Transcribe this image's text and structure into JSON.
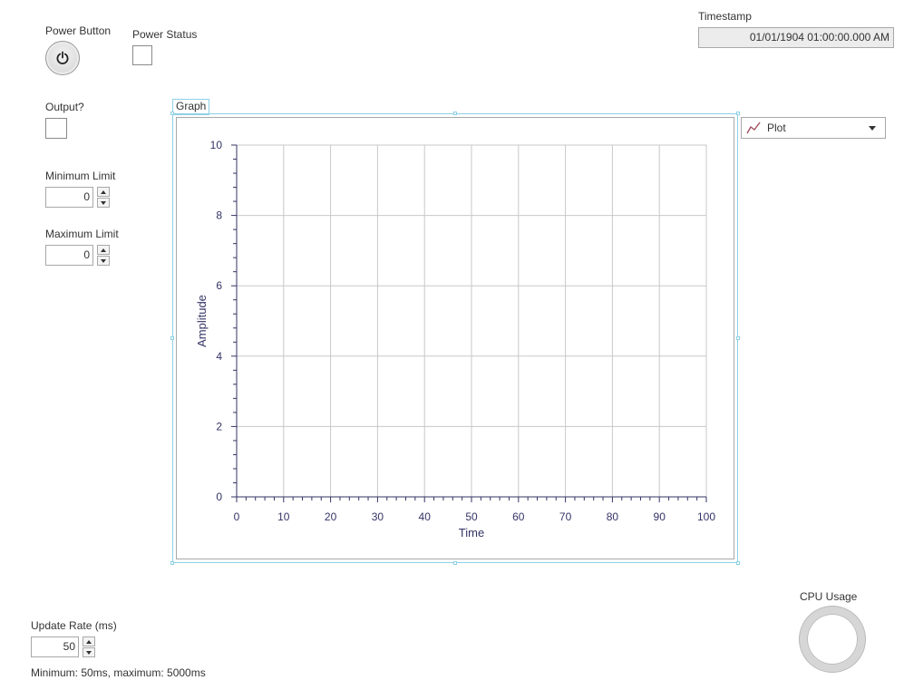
{
  "power": {
    "label": "Power Button",
    "icon": "power-icon"
  },
  "power_status": {
    "label": "Power Status"
  },
  "timestamp": {
    "label": "Timestamp",
    "value": "01/01/1904 01:00:00.000 AM"
  },
  "output": {
    "label": "Output?"
  },
  "min_limit": {
    "label": "Minimum Limit",
    "value": "0"
  },
  "max_limit": {
    "label": "Maximum Limit",
    "value": "0"
  },
  "graph": {
    "label": "Graph",
    "legend": {
      "plot_name": "Plot",
      "icon": "line-plot-icon",
      "plot_color": "#a05060"
    }
  },
  "chart_data": {
    "type": "line",
    "title": "",
    "xlabel": "Time",
    "ylabel": "Amplitude",
    "xlim": [
      0,
      100
    ],
    "ylim": [
      0,
      10
    ],
    "x_ticks": [
      0,
      10,
      20,
      30,
      40,
      50,
      60,
      70,
      80,
      90,
      100
    ],
    "y_ticks": [
      0,
      2,
      4,
      6,
      8,
      10
    ],
    "grid": true,
    "series": [
      {
        "name": "Plot",
        "values": []
      }
    ],
    "colors": {
      "axis": "#333366",
      "grid": "#c8c8c8",
      "tick_label": "#333366"
    }
  },
  "update_rate": {
    "label": "Update Rate (ms)",
    "value": "50",
    "hint": "Minimum: 50ms, maximum: 5000ms"
  },
  "cpu": {
    "label": "CPU Usage"
  }
}
